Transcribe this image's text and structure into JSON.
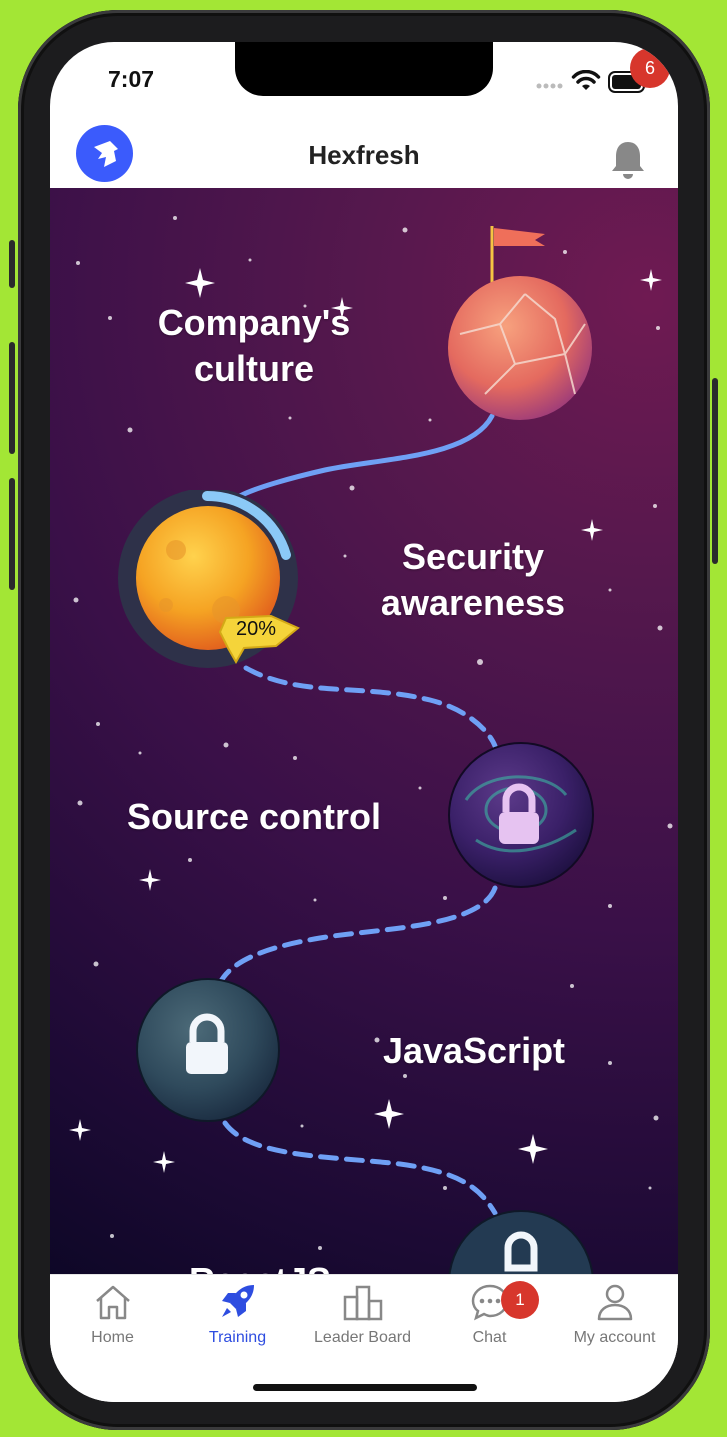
{
  "status_bar": {
    "time": "7:07"
  },
  "header": {
    "title": "Hexfresh",
    "notification_count": "6"
  },
  "map": {
    "levels": [
      {
        "label": "Company's\nculture",
        "state": "goal"
      },
      {
        "label": "Security\nawareness",
        "state": "in-progress",
        "progress_text": "20%",
        "progress": 0.2
      },
      {
        "label": "Source control",
        "state": "locked"
      },
      {
        "label": "JavaScript",
        "state": "locked"
      },
      {
        "label": "ReactJS",
        "state": "locked"
      }
    ]
  },
  "bottom_nav": {
    "items": [
      {
        "label": "Home",
        "icon": "home-icon"
      },
      {
        "label": "Training",
        "icon": "rocket-icon",
        "active": true
      },
      {
        "label": "Leader Board",
        "icon": "leaderboard-icon"
      },
      {
        "label": "Chat",
        "icon": "chat-icon",
        "badge": "1"
      },
      {
        "label": "My account",
        "icon": "user-icon"
      }
    ]
  },
  "colors": {
    "accent": "#2e4de0",
    "badge": "#d7362c",
    "path": "#6fa0f5",
    "background": "#a3e635"
  }
}
